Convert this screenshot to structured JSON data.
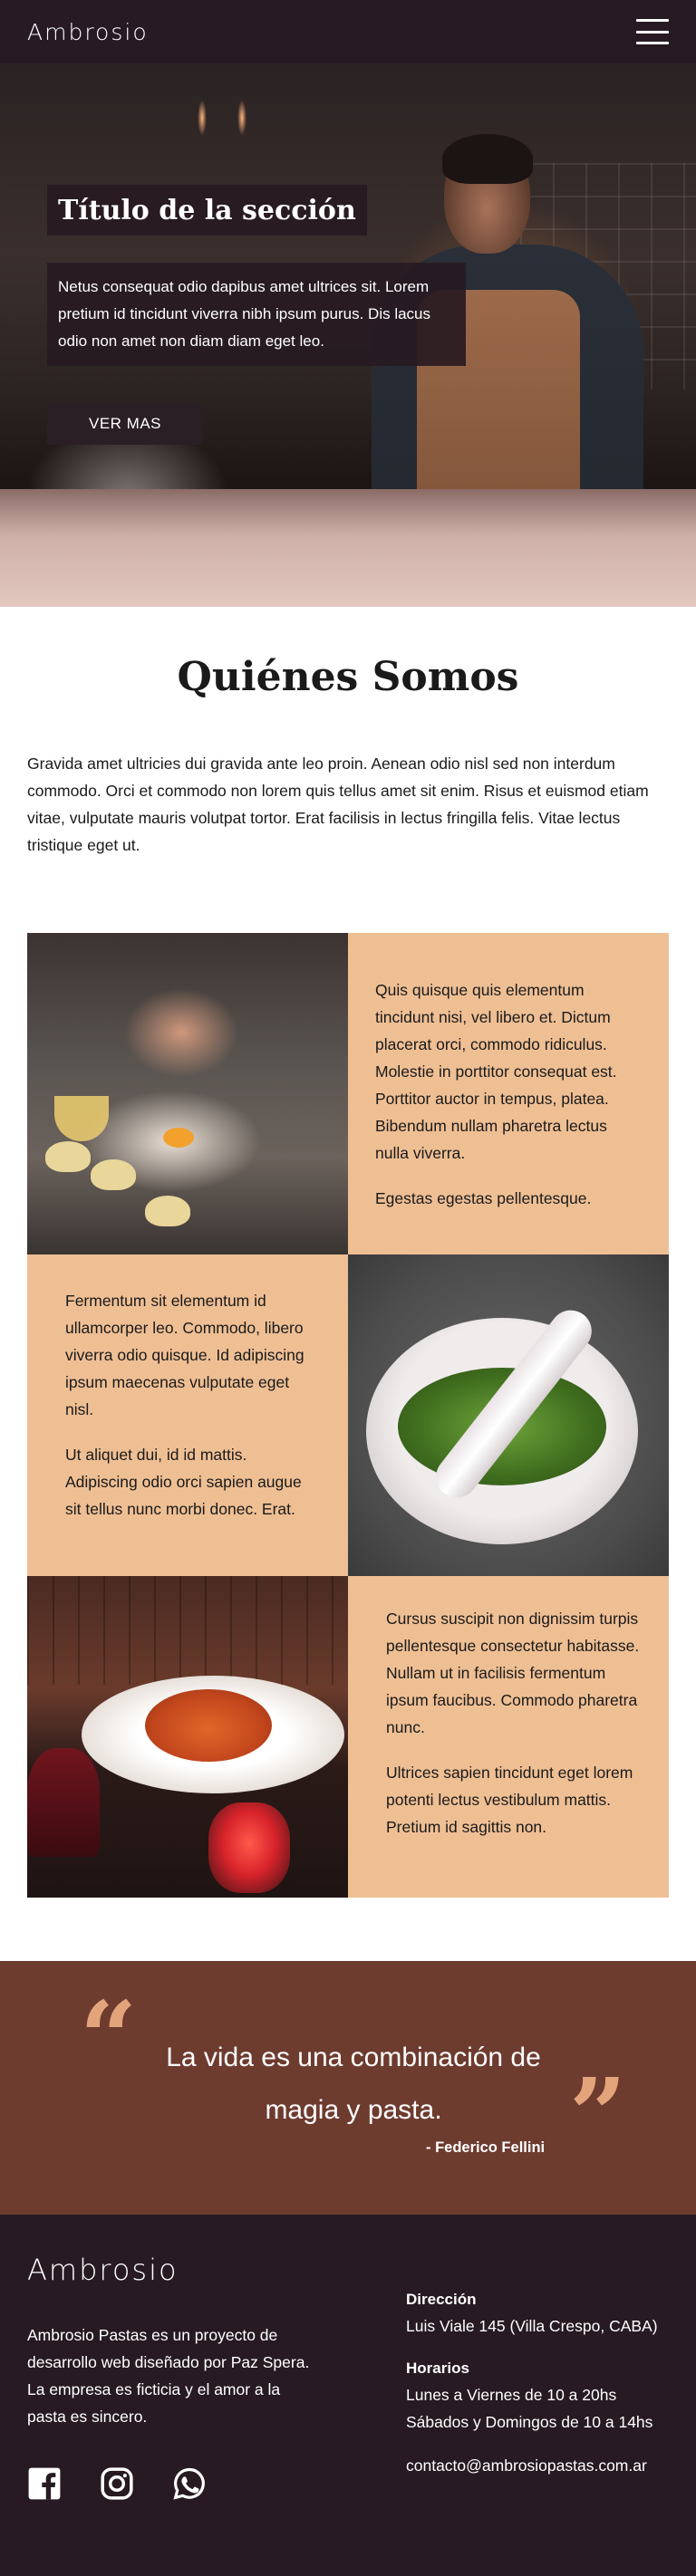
{
  "navbar": {
    "brand": "Ambrosio",
    "menu_icon": "hamburger-menu-icon"
  },
  "hero": {
    "title": "Título de la sección",
    "text": "Netus consequat odio dapibus amet ultrices sit. Lorem pretium id tincidunt viverra nibh ipsum purus. Dis lacus odio non amet non diam diam eget leo.",
    "button_label": "VER MAS"
  },
  "about": {
    "title": "Quiénes Somos",
    "text": "Gravida amet ultricies dui gravida ante leo proin. Aenean odio nisl sed non interdum commodo. Orci et commodo non lorem quis tellus amet sit enim. Risus et euismod etiam vitae, vulputate mauris volutpat tortor. Erat facilisis in lectus fringilla felis. Vitae lectus tristique eget ut."
  },
  "grid": {
    "cell1": {
      "p1": "Quis quisque quis elementum tincidunt nisi, vel libero et. Dictum placerat orci, commodo ridiculus. Molestie in porttitor consequat est. Porttitor auctor in tempus, platea. Bibendum nullam pharetra lectus nulla viverra.",
      "p2": "Egestas egestas pellentesque."
    },
    "cell2": {
      "p1": "Fermentum sit elementum id ullamcorper leo. Commodo, libero viverra odio quisque. Id adipiscing ipsum maecenas vulputate eget nisl.",
      "p2": "Ut aliquet dui, id id mattis. Adipiscing odio orci sapien augue sit tellus nunc morbi donec. Erat."
    },
    "cell3": {
      "p1": "Cursus suscipit non dignissim turpis pellentesque consectetur habitasse. Nullam ut in facilisis fermentum ipsum faucibus. Commodo pharetra nunc.",
      "p2": "Ultrices sapien tincidunt eget lorem potenti lectus vestibulum mattis. Pretium id sagittis non."
    }
  },
  "quote": {
    "open_mark": "“",
    "close_mark": "”",
    "text": "La vida es una combinación de magia y pasta.",
    "author": "- Federico Fellini"
  },
  "footer": {
    "brand": "Ambrosio",
    "description": "Ambrosio Pastas es un proyecto de desarrollo web diseñado por Paz Spera. La empresa es ficticia y el amor a la pasta es sincero.",
    "address_label": "Dirección",
    "address_value": "Luis Viale 145 (Villa Crespo, CABA)",
    "hours_label": "Horarios",
    "hours_weekdays": "Lunes a Viernes de 10 a 20hs",
    "hours_weekend": "Sábados y Domingos de 10 a 14hs",
    "email": "contacto@ambrosiopastas.com.ar",
    "social": [
      "facebook-icon",
      "instagram-icon",
      "whatsapp-icon"
    ]
  },
  "colors": {
    "dark": "#271a22",
    "peach": "#efbf94",
    "quote_bg": "#6e3b2f",
    "quote_mark": "#e3a47c"
  }
}
